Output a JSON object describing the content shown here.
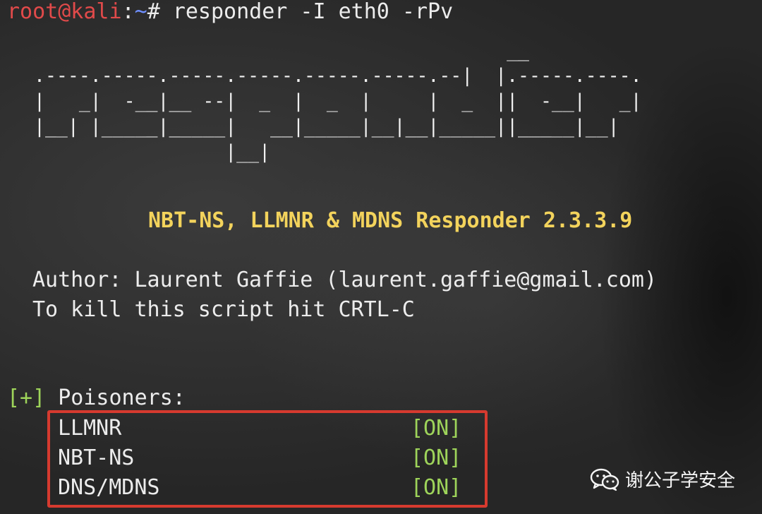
{
  "prompt": {
    "user": "root@kali",
    "sep": ":",
    "path": "~",
    "symbol": "# ",
    "command": "responder -I eth0 -rPv"
  },
  "ascii_art": [
    "                                          __",
    ".----.-----.-----.-----.-----.-----.--|  |.-----.----.",
    "|   _|  -__|__ --|  _  |  _  |     |  _  ||  -__|   _|",
    "|__| |_____|_____|   __|_____|__|__|_____||_____|__|",
    "                 |__|"
  ],
  "banner": "NBT-NS, LLMNR & MDNS Responder 2.3.3.9",
  "author_line": "Author: Laurent Gaffie (laurent.gaffie@gmail.com)",
  "kill_line": "To kill this script hit CRTL-C",
  "poisoners": {
    "marker": "[+]",
    "heading": " Poisoners:",
    "items": [
      {
        "name": "LLMNR",
        "status": "[ON]"
      },
      {
        "name": "NBT-NS",
        "status": "[ON]"
      },
      {
        "name": "DNS/MDNS",
        "status": "[ON]"
      }
    ]
  },
  "watermark": {
    "text": "谢公子学安全",
    "icon": "wechat-icon"
  },
  "colors": {
    "user": "#e14a4a",
    "path": "#6f8fff",
    "banner": "#f3d35c",
    "status_on": "#9ed45a",
    "highlight_border": "#d63a2f"
  }
}
